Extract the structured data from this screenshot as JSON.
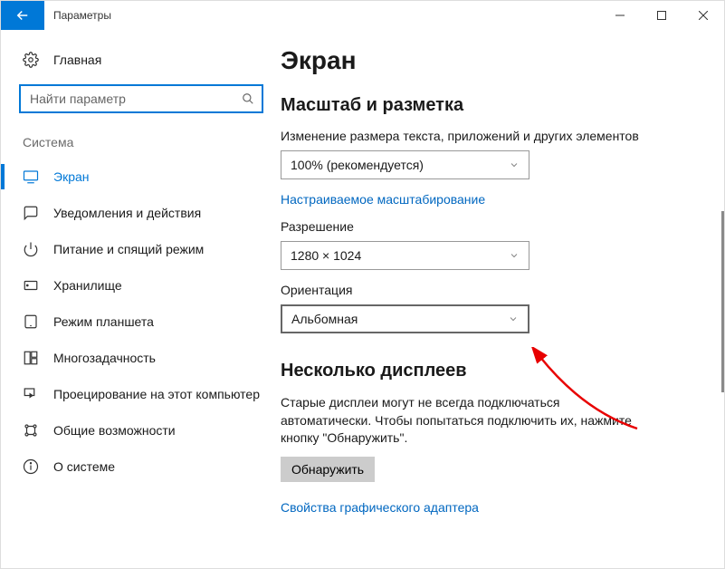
{
  "titlebar": {
    "title": "Параметры"
  },
  "sidebar": {
    "home": "Главная",
    "search_placeholder": "Найти параметр",
    "section": "Система",
    "items": [
      {
        "label": "Экран",
        "icon": "display-icon",
        "active": true
      },
      {
        "label": "Уведомления и действия",
        "icon": "comment-icon"
      },
      {
        "label": "Питание и спящий режим",
        "icon": "power-icon"
      },
      {
        "label": "Хранилище",
        "icon": "storage-icon"
      },
      {
        "label": "Режим планшета",
        "icon": "tablet-icon"
      },
      {
        "label": "Многозадачность",
        "icon": "multitask-icon"
      },
      {
        "label": "Проецирование на этот компьютер",
        "icon": "project-icon"
      },
      {
        "label": "Общие возможности",
        "icon": "shared-icon"
      },
      {
        "label": "О системе",
        "icon": "info-icon"
      }
    ]
  },
  "main": {
    "page_title": "Экран",
    "scale_heading": "Масштаб и разметка",
    "scale_label": "Изменение размера текста, приложений и других элементов",
    "scale_value": "100% (рекомендуется)",
    "custom_scaling_link": "Настраиваемое масштабирование",
    "resolution_label": "Разрешение",
    "resolution_value": "1280 × 1024",
    "orientation_label": "Ориентация",
    "orientation_value": "Альбомная",
    "multi_heading": "Несколько дисплеев",
    "multi_desc": "Старые дисплеи могут не всегда подключаться автоматически. Чтобы попытаться подключить их, нажмите кнопку \"Обнаружить\".",
    "detect_button": "Обнаружить",
    "gpu_link": "Свойства графического адаптера"
  }
}
